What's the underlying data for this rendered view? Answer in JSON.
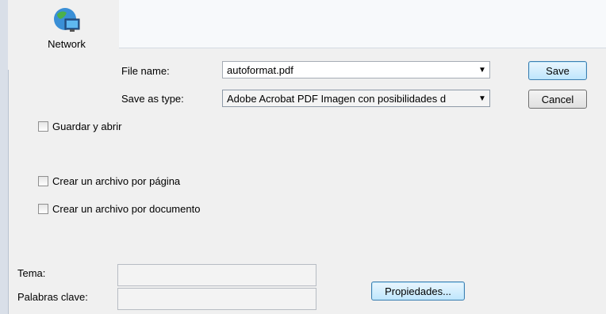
{
  "places": {
    "network_label": "Network"
  },
  "form": {
    "file_name_label": "File name:",
    "file_name_value": "autoformat.pdf",
    "save_type_label": "Save as type:",
    "save_type_value": "Adobe Acrobat PDF Imagen con posibilidades d",
    "save_label": "Save",
    "cancel_label": "Cancel"
  },
  "options": {
    "open_after_save": {
      "label": "Guardar y abrir",
      "checked": false
    },
    "one_file_per_page": {
      "label": "Crear un archivo por página",
      "checked": false
    },
    "one_file_per_document": {
      "label": "Crear un archivo por documento",
      "checked": false
    }
  },
  "metadata": {
    "topic_label": "Tema:",
    "keywords_label": "Palabras clave:",
    "properties_label": "Propiedades..."
  },
  "icons": {
    "network": "network-globe-icon",
    "dropdown": "chevron-down-icon"
  },
  "colors": {
    "default_button_border": "#3c7fb1",
    "default_button_fill": "#bee6fd"
  }
}
